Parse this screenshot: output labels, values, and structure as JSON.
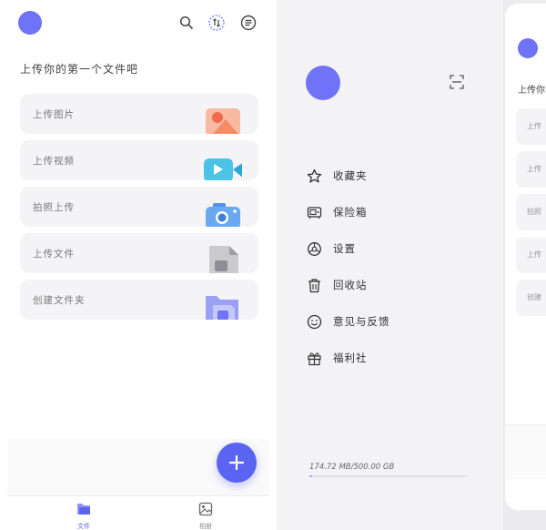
{
  "left": {
    "prompt": "上传你的第一个文件吧",
    "cards": [
      {
        "label": "上传图片",
        "icon": "image-upload-icon"
      },
      {
        "label": "上传视频",
        "icon": "video-upload-icon"
      },
      {
        "label": "拍照上传",
        "icon": "camera-upload-icon"
      },
      {
        "label": "上传文件",
        "icon": "file-upload-icon"
      },
      {
        "label": "创建文件夹",
        "icon": "folder-create-icon"
      }
    ],
    "nav": [
      {
        "label": "文件",
        "icon": "files-icon",
        "active": true
      },
      {
        "label": "相册",
        "icon": "album-icon",
        "active": false
      }
    ],
    "accent": "#5b64f0",
    "avatar_color": "#6e73f7"
  },
  "drawer": {
    "menu": [
      {
        "label": "收藏夹",
        "icon": "star-icon"
      },
      {
        "label": "保险箱",
        "icon": "safe-icon"
      },
      {
        "label": "设置",
        "icon": "settings-icon"
      },
      {
        "label": "回收站",
        "icon": "trash-icon"
      },
      {
        "label": "意见与反馈",
        "icon": "smile-icon"
      },
      {
        "label": "福利社",
        "icon": "gift-icon"
      }
    ],
    "storage": {
      "text": "174.72 MB/500.00 GB",
      "used_fraction": 0.0003
    }
  },
  "right_partial": {
    "prompt": "上传你",
    "cards": [
      "上传",
      "上传",
      "拍照",
      "上传",
      "创建"
    ]
  }
}
